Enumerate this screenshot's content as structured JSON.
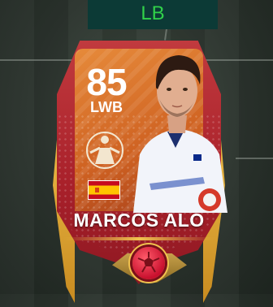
{
  "position_slot": "LB",
  "card": {
    "rating": "85",
    "position": "LWB",
    "player_name": "MARCOS ALO",
    "nation": "Spain",
    "nation_flag_colors": {
      "red": "#c60b1e",
      "yellow": "#ffc400"
    },
    "card_colors": {
      "frame": "#a8202a",
      "top": "#e68a3a",
      "trim": "#f0c24e"
    }
  },
  "icons": {
    "program_badge": "program-badge-icon",
    "ball": "soccer-ball-icon"
  }
}
